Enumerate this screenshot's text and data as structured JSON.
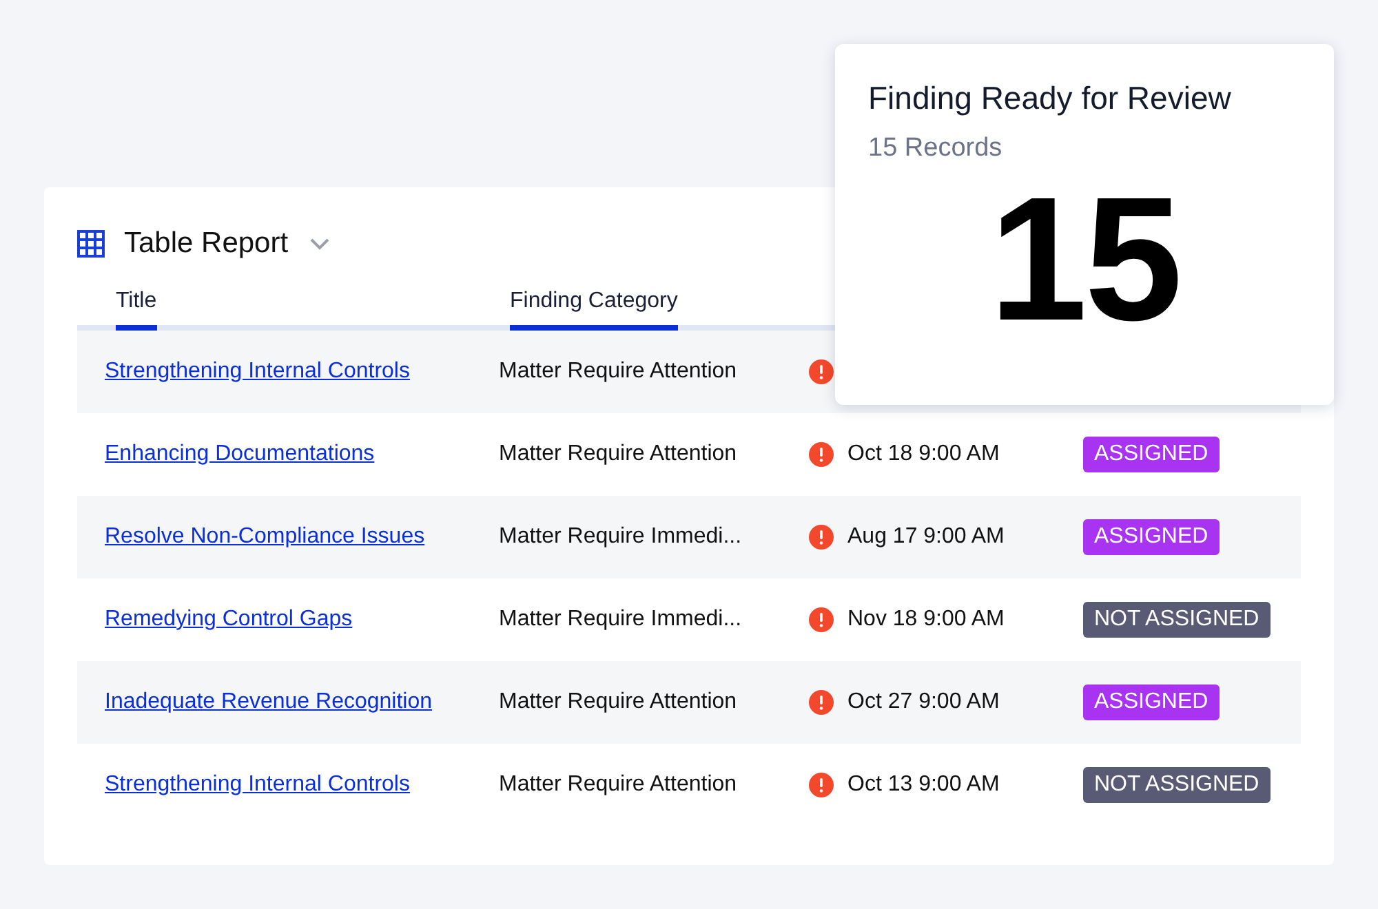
{
  "report": {
    "title": "Table Report",
    "columns": [
      {
        "label": "Title",
        "active": true
      },
      {
        "label": "Finding Category",
        "active": true
      }
    ],
    "rows": [
      {
        "title": "Strengthening Internal Controls",
        "category": "Matter Require Attention",
        "alert": true
      },
      {
        "title": "Enhancing Documentations",
        "category": "Matter Require Attention",
        "alert": true,
        "date": "Oct 18 9:00 AM",
        "status": {
          "label": "ASSIGNED",
          "color": "#a833f0"
        }
      },
      {
        "title": "Resolve Non-Compliance Issues",
        "category": "Matter Require Immedi...",
        "alert": true,
        "date": "Aug 17 9:00 AM",
        "status": {
          "label": "ASSIGNED",
          "color": "#a833f0"
        }
      },
      {
        "title": "Remedying Control Gaps",
        "category": "Matter Require Immedi...",
        "alert": true,
        "date": "Nov 18 9:00 AM",
        "status": {
          "label": "NOT ASSIGNED",
          "color": "#585b73"
        }
      },
      {
        "title": "Inadequate Revenue Recognition",
        "category": "Matter Require Attention",
        "alert": true,
        "date": "Oct 27 9:00 AM",
        "status": {
          "label": "ASSIGNED",
          "color": "#a833f0"
        }
      },
      {
        "title": "Strengthening Internal Controls",
        "category": "Matter Require Attention",
        "alert": true,
        "date": "Oct 13 9:00 AM",
        "status": {
          "label": "NOT ASSIGNED",
          "color": "#585b73"
        }
      }
    ]
  },
  "summary_card": {
    "title": "Finding Ready for Review",
    "subtitle": "15 Records",
    "value": "15"
  }
}
